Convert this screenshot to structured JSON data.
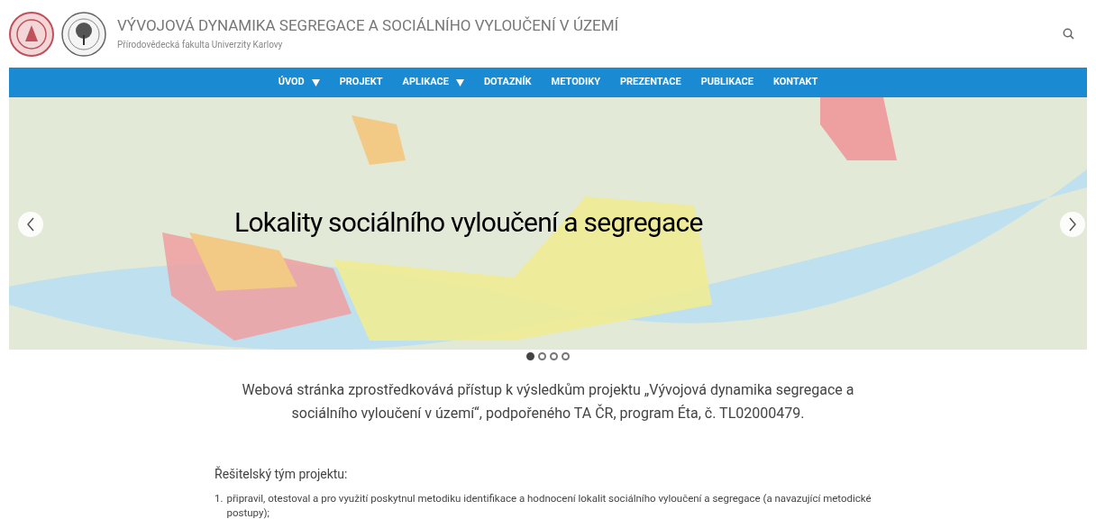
{
  "header": {
    "title": "VÝVOJOVÁ DYNAMIKA SEGREGACE A SOCIÁLNÍHO VYLOUČENÍ V ÚZEMÍ",
    "subtitle": "Přírodovědecká fakulta Univerzity Karlovy"
  },
  "nav": [
    {
      "label": "ÚVOD",
      "dropdown": true
    },
    {
      "label": "PROJEKT",
      "dropdown": false
    },
    {
      "label": "APLIKACE",
      "dropdown": true
    },
    {
      "label": "DOTAZNÍK",
      "dropdown": false
    },
    {
      "label": "METODIKY",
      "dropdown": false
    },
    {
      "label": "PREZENTACE",
      "dropdown": false
    },
    {
      "label": "PUBLIKACE",
      "dropdown": false
    },
    {
      "label": "KONTAKT",
      "dropdown": false
    }
  ],
  "slider": {
    "caption": "Lokality sociálního vyloučení a segregace",
    "indicators": [
      {
        "selected": true
      },
      {
        "selected": false
      },
      {
        "selected": false
      },
      {
        "selected": false
      }
    ]
  },
  "intro": "Webová stránka zprostředkovává přístup k výsledkům projektu „Vývojová dynamika segregace a sociálního vyloučení v území“, podpořeného TA ČR, program Éta, č. TL02000479.",
  "team_heading": "Řešitelský tým projektu:",
  "team_list": [
    {
      "number": "1.",
      "text": "připravil, otestoval a pro využití poskytnul metodiku identifikace a hodnocení lokalit sociálního vyloučení a segregace (a navazující metodické postupy);"
    }
  ]
}
